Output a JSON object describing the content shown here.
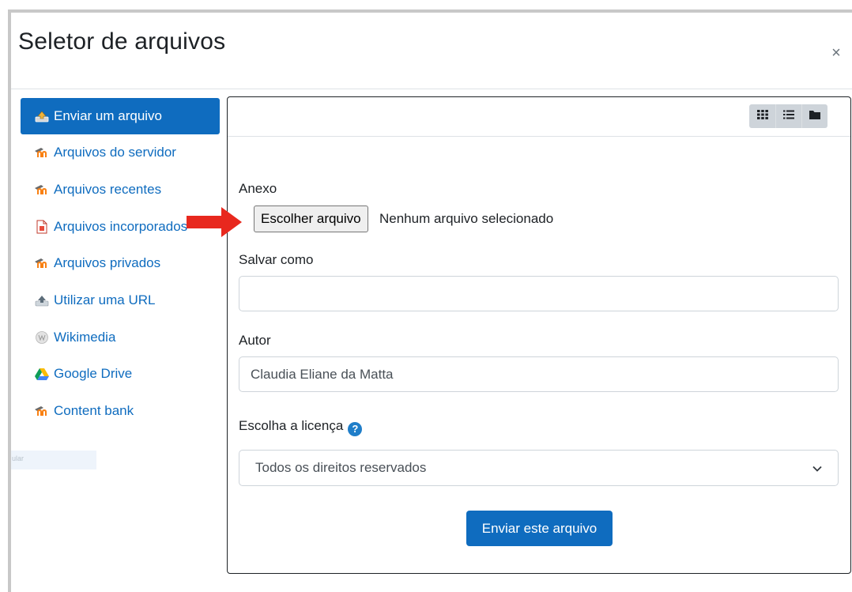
{
  "dialog": {
    "title": "Seletor de arquivos",
    "close_glyph": "×"
  },
  "sidebar": {
    "items": [
      {
        "label": "Enviar um arquivo",
        "icon": "upload-icon",
        "active": true
      },
      {
        "label": "Arquivos do servidor",
        "icon": "moodle-icon",
        "active": false
      },
      {
        "label": "Arquivos recentes",
        "icon": "moodle-icon",
        "active": false
      },
      {
        "label": "Arquivos incorporados",
        "icon": "embedded-file-icon",
        "active": false
      },
      {
        "label": "Arquivos privados",
        "icon": "moodle-icon",
        "active": false
      },
      {
        "label": "Utilizar uma URL",
        "icon": "url-download-icon",
        "active": false
      },
      {
        "label": "Wikimedia",
        "icon": "wikimedia-icon",
        "active": false
      },
      {
        "label": "Google Drive",
        "icon": "google-drive-icon",
        "active": false
      },
      {
        "label": "Content bank",
        "icon": "moodle-icon",
        "active": false
      }
    ],
    "ghost_text": "ular"
  },
  "toolbar": {
    "views": [
      "grid-view-icon",
      "list-view-icon",
      "folder-view-icon"
    ]
  },
  "form": {
    "attachment_label": "Anexo",
    "choose_file_label": "Escolher arquivo",
    "no_file_text": "Nenhum arquivo selecionado",
    "save_as_label": "Salvar como",
    "save_as_value": "",
    "author_label": "Autor",
    "author_value": "Claudia Eliane da Matta",
    "license_label": "Escolha a licença",
    "license_value": "Todos os direitos reservados",
    "submit_label": "Enviar este arquivo"
  },
  "colors": {
    "primary": "#0f6cbf",
    "arrow": "#e8281e"
  }
}
